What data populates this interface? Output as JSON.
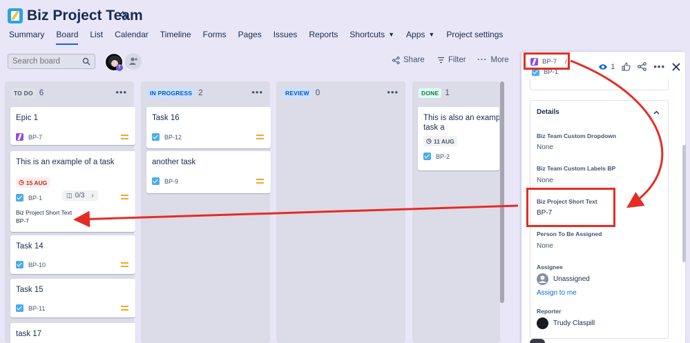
{
  "header": {
    "project_title": "Biz Project Team",
    "tabs": [
      {
        "label": "Summary"
      },
      {
        "label": "Board",
        "active": true
      },
      {
        "label": "List"
      },
      {
        "label": "Calendar"
      },
      {
        "label": "Timeline"
      },
      {
        "label": "Forms"
      },
      {
        "label": "Pages"
      },
      {
        "label": "Issues"
      },
      {
        "label": "Reports"
      },
      {
        "label": "Shortcuts",
        "dropdown": true
      },
      {
        "label": "Apps",
        "dropdown": true
      },
      {
        "label": "Project settings"
      }
    ]
  },
  "toolbar": {
    "search_placeholder": "Search board",
    "avatar_badge": "T",
    "share_label": "Share",
    "filter_label": "Filter",
    "more_label": "More"
  },
  "columns": [
    {
      "name": "TO DO",
      "count": "6",
      "tag_bg": "#dfe1e6",
      "tag_fg": "#44546f"
    },
    {
      "name": "IN PROGRESS",
      "count": "2",
      "tag_bg": "#cce0ff",
      "tag_fg": "#0055cc"
    },
    {
      "name": "REVIEW",
      "count": "0",
      "tag_bg": "#cce0ff",
      "tag_fg": "#0055cc"
    },
    {
      "name": "DONE",
      "count": "1",
      "tag_bg": "#dcfff1",
      "tag_fg": "#216e4e"
    }
  ],
  "cards": {
    "todo": [
      {
        "title": "Epic 1",
        "key": "BP-7",
        "type": "epic-icon"
      },
      {
        "title": "This is an example of a task",
        "date": "15 AUG",
        "key": "BP-1",
        "subtasks": "0/3",
        "field_label": "Biz Project Short Text",
        "field_value": "BP-7"
      },
      {
        "title": "Task 14",
        "key": "BP-10"
      },
      {
        "title": "Task 15",
        "key": "BP-11"
      },
      {
        "title": "task 17"
      }
    ],
    "in_progress": [
      {
        "title": "Task 16",
        "key": "BP-12"
      },
      {
        "title": "another task",
        "key": "BP-9"
      }
    ],
    "done": [
      {
        "title_line1": "This is also an example o",
        "title_line2": "task a",
        "date": "11 AUG",
        "key": "BP-2"
      }
    ]
  },
  "panel": {
    "crumb_key": "BP-7",
    "crumb_sep": "/",
    "parent_key": "BP-1",
    "watch_count": "1",
    "details_title": "Details",
    "fields": [
      {
        "label": "Biz Team Custom Dropdown",
        "value": "None"
      },
      {
        "label": "Biz Team Custom Labels BP",
        "value": "None"
      },
      {
        "label": "Biz Project Short Text",
        "value": "BP-7"
      },
      {
        "label": "Person To Be Assigned",
        "value": "None"
      },
      {
        "label": "Assignee",
        "value": "Unassigned",
        "link": "Assign to me"
      },
      {
        "label": "Reporter",
        "value": "Trudy Claspill"
      }
    ]
  },
  "colors": {
    "accent": "#0c66e4",
    "highlight": "#e32d23",
    "priority": "#f5a623",
    "date_overdue_bg": "#ffeceb",
    "date_overdue_fg": "#ae2e24"
  }
}
